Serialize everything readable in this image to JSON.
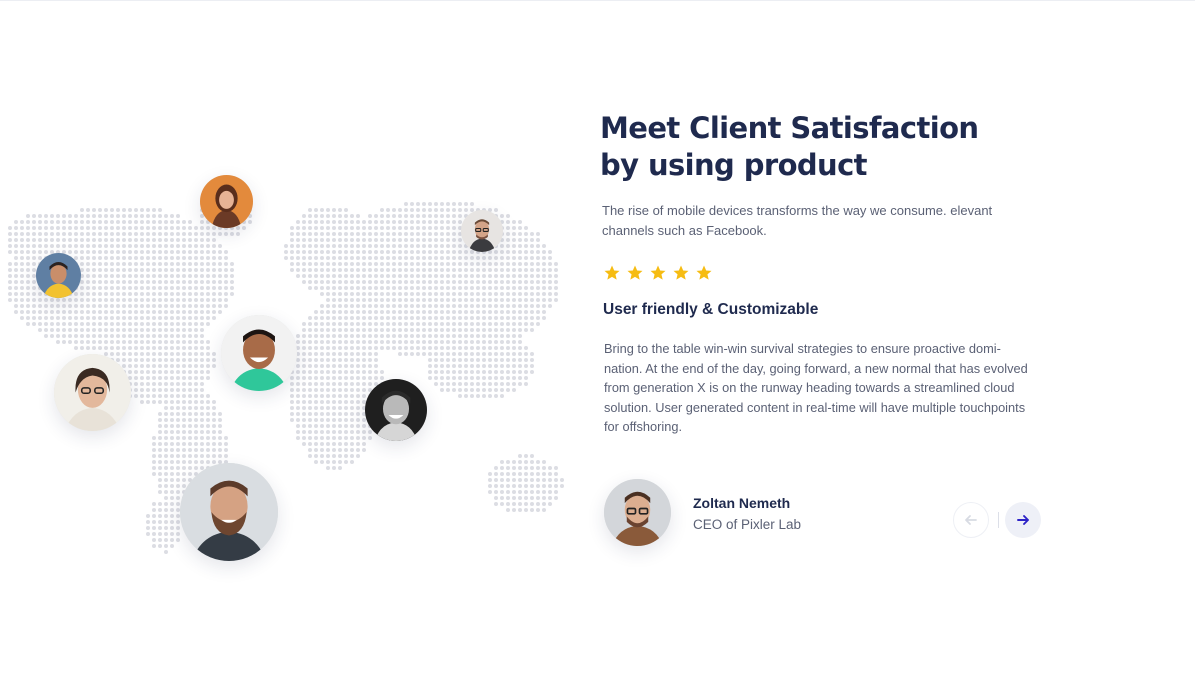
{
  "section": {
    "heading_line1": "Meet Client Satisfaction",
    "heading_line2": "by using product",
    "intro": "The rise of mobile devices transforms the way we consume. elevant channels such as Facebook."
  },
  "rating": {
    "stars": 5,
    "star_color": "#f6bc12"
  },
  "review": {
    "title": "User friendly & Customizable",
    "body": "Bring to the table win-win survival strategies to ensure proactive domi-nation. At the end of the day, going forward, a new normal that has evolved from generation X is on the runway heading towards a streamlined cloud solution. User generated content in real-time will have multiple touchpoints for offshoring."
  },
  "author": {
    "name": "Zoltan Nemeth",
    "role": "CEO of Pixler Lab"
  },
  "nav": {
    "prev_icon": "arrow-left-icon",
    "next_icon": "arrow-right-icon",
    "next_color": "#2d23c7"
  },
  "colors": {
    "heading": "#1f2a4e",
    "text": "#5b6175",
    "map_dot": "#dcdde3"
  }
}
